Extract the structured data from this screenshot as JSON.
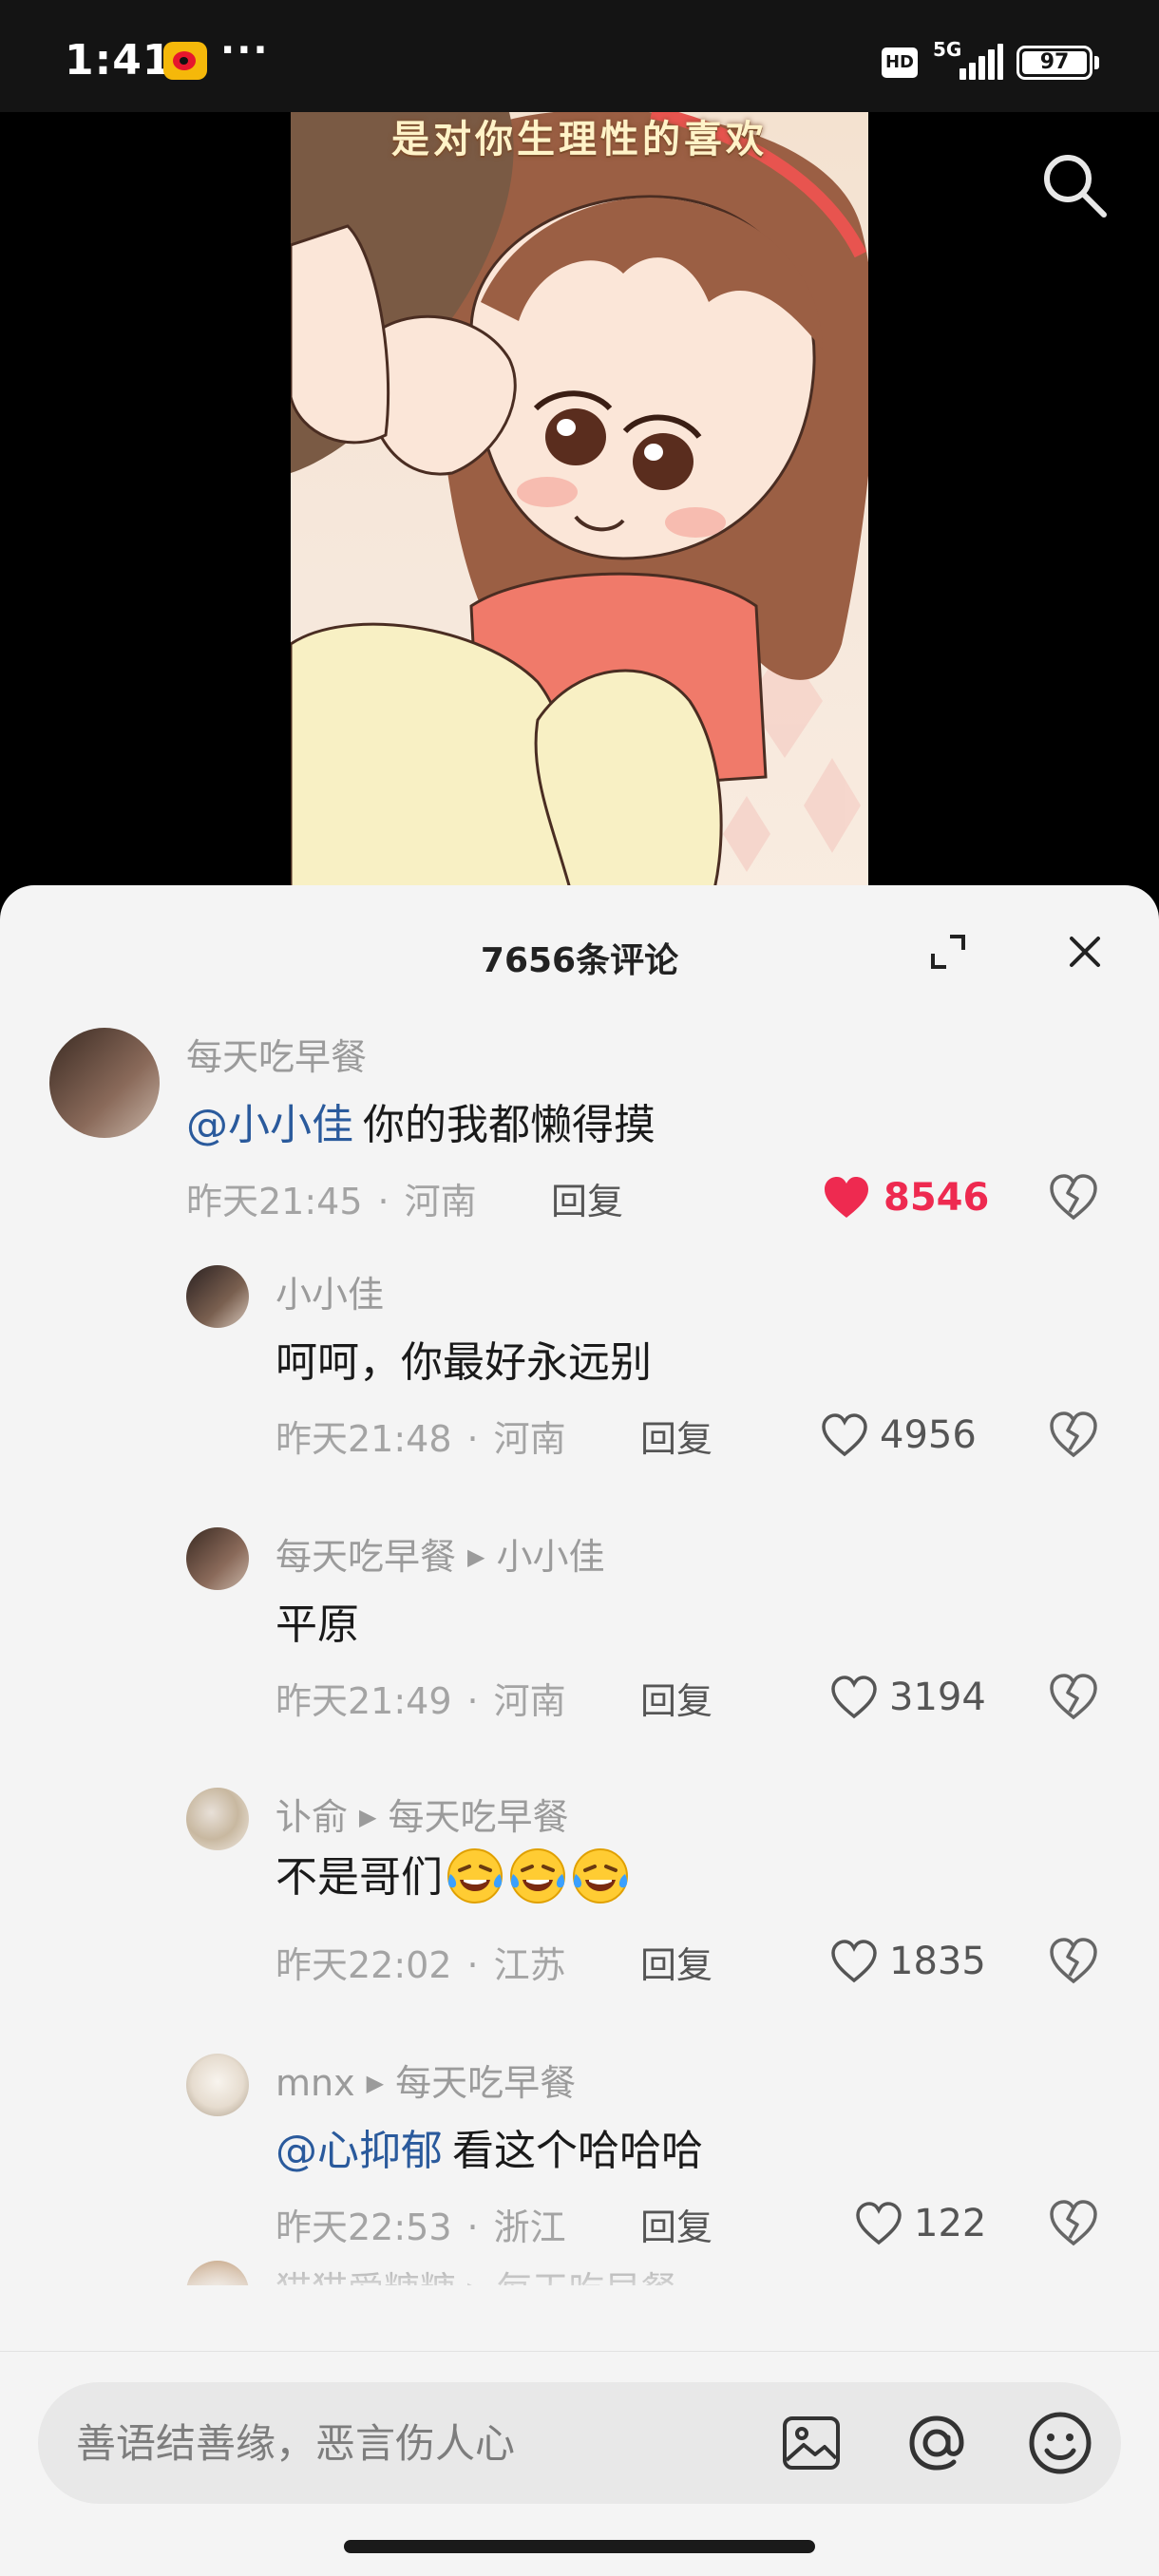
{
  "status_bar": {
    "time": "1:41",
    "app_icon": "weibo-icon",
    "more": "···",
    "hd": "HD",
    "network": "5G",
    "battery": "97",
    "battery_level_percent": 97
  },
  "video": {
    "caption": "是对你生理性的喜欢",
    "search_icon": "search-icon"
  },
  "comments_panel": {
    "title": "7656条评论",
    "expand_icon": "expand-icon",
    "close_icon": "close-icon",
    "reply_label": "回复",
    "separator": "·",
    "items": [
      {
        "user": "每天吃早餐",
        "reply_to": "",
        "mention": "@小小佳",
        "text": "你的我都懒得摸",
        "time": "昨天21:45",
        "location": "河南",
        "likes": "8546",
        "liked": true,
        "level": "top"
      },
      {
        "user": "小小佳",
        "reply_to": "",
        "mention": "",
        "text": "呵呵，你最好永远别",
        "time": "昨天21:48",
        "location": "河南",
        "likes": "4956",
        "liked": false,
        "level": "reply"
      },
      {
        "user": "每天吃早餐",
        "reply_to": "小小佳",
        "mention": "",
        "text": "平原",
        "time": "昨天21:49",
        "location": "河南",
        "likes": "3194",
        "liked": false,
        "level": "reply"
      },
      {
        "user": "讣俞",
        "reply_to": "每天吃早餐",
        "mention": "",
        "text": "不是哥们",
        "emojis": [
          "laughing-crying-emoji",
          "laughing-crying-emoji",
          "laughing-crying-emoji"
        ],
        "time": "昨天22:02",
        "location": "江苏",
        "likes": "1835",
        "liked": false,
        "level": "reply"
      },
      {
        "user": "mnx",
        "reply_to": "每天吃早餐",
        "mention": "@心抑郁",
        "text": "看这个哈哈哈",
        "time": "昨天22:53",
        "location": "浙江",
        "likes": "122",
        "liked": false,
        "level": "reply"
      },
      {
        "user": "猫猫爱糖糖",
        "reply_to": "每天吃早餐",
        "mention": "",
        "text": "",
        "time": "",
        "location": "",
        "likes": "",
        "liked": false,
        "level": "reply-partial"
      }
    ]
  },
  "input_bar": {
    "placeholder": "善语结善缘，恶言伤人心",
    "icons": [
      "image-icon",
      "at-icon",
      "emoji-icon"
    ]
  },
  "colors": {
    "accent_like": "#ee2a50",
    "mention": "#2a5a9c",
    "sheet_bg": "#f4f4f4"
  }
}
